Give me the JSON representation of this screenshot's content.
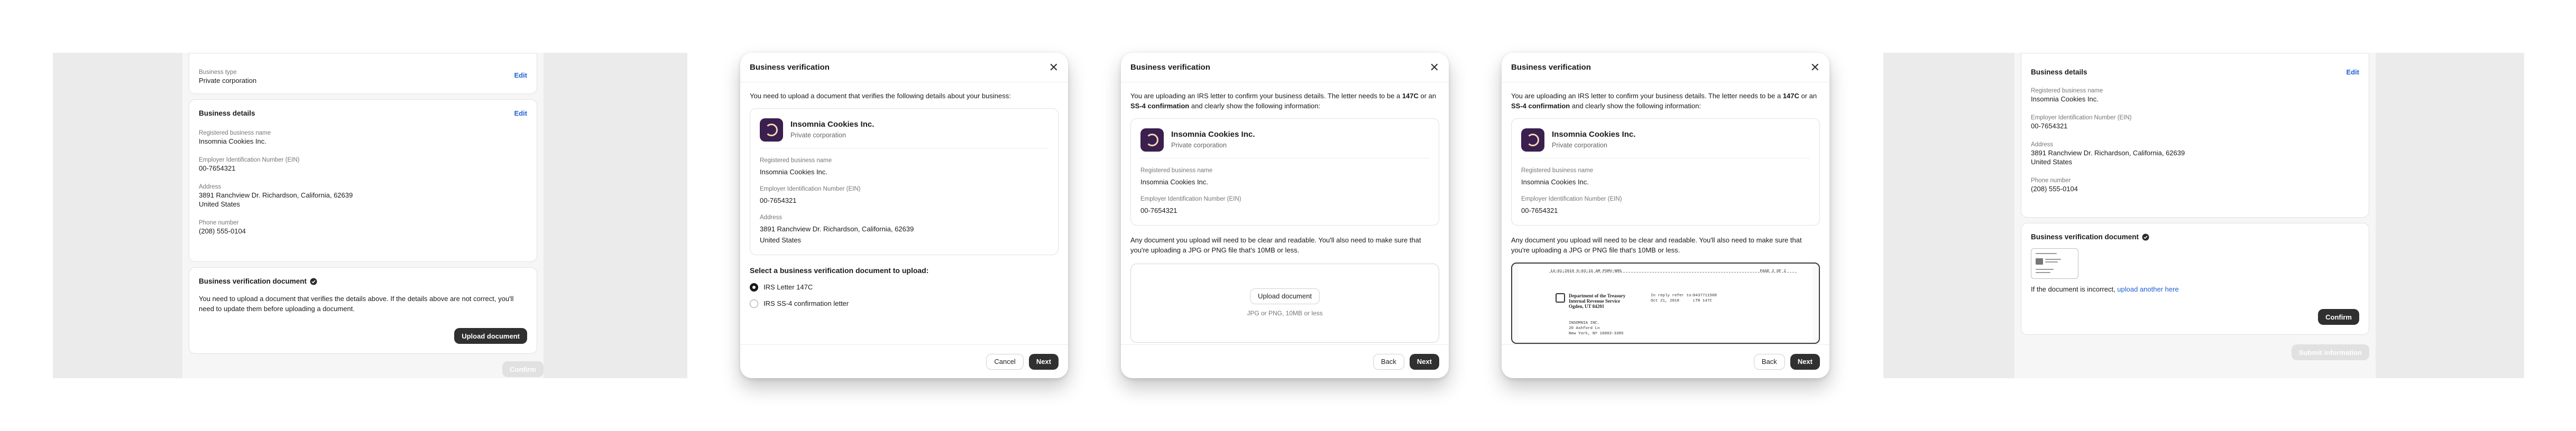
{
  "colors": {
    "accent": "#1f5fd6",
    "primary_button": "#303030",
    "panel_bg": "#ebebeb"
  },
  "icons": {
    "close": "close-icon",
    "verified": "checkmark-badge-icon",
    "company": "company-logo-icon"
  },
  "panel1": {
    "business_type": {
      "label": "Business type",
      "value": "Private corporation",
      "edit": "Edit"
    },
    "business_details": {
      "title": "Business details",
      "edit": "Edit",
      "fields": [
        {
          "label": "Registered business name",
          "lines": [
            "Insomnia Cookies Inc."
          ]
        },
        {
          "label": "Employer Identification Number (EIN)",
          "lines": [
            "00-7654321"
          ]
        },
        {
          "label": "Address",
          "lines": [
            "3891 Ranchview Dr. Richardson, California, 62639",
            "United States"
          ]
        },
        {
          "label": "Phone number",
          "lines": [
            "(208) 555-0104"
          ]
        }
      ]
    },
    "verification": {
      "title": "Business verification document",
      "text": "You need to upload a document that verifies the details above. If the details above are not correct, you'll need to update them before uploading a document.",
      "upload_button": "Upload document"
    },
    "confirm_button": "Confirm"
  },
  "dialog1": {
    "title": "Business verification",
    "intro": "You need to upload a document that verifies the following details about your business:",
    "company": {
      "name": "Insomnia Cookies Inc.",
      "type": "Private corporation"
    },
    "fields": [
      {
        "label": "Registered business name",
        "lines": [
          "Insomnia Cookies Inc."
        ]
      },
      {
        "label": "Employer Identification Number (EIN)",
        "lines": [
          "00-7654321"
        ]
      },
      {
        "label": "Address",
        "lines": [
          "3891 Ranchview Dr. Richardson, California, 62639",
          "United States"
        ]
      }
    ],
    "select_heading": "Select a business verification document to upload:",
    "options": [
      "IRS Letter 147C",
      "IRS SS-4 confirmation letter"
    ],
    "selected": "IRS Letter 147C",
    "cancel": "Cancel",
    "next": "Next"
  },
  "dialog2": {
    "title": "Business verification",
    "intro": {
      "p1": "You are uploading an IRS letter to confirm your business details. The letter needs to be a ",
      "b1": "147C",
      "p2": " or an ",
      "b2": "SS-4 confirmation",
      "p3": " and clearly show the following information:"
    },
    "company": {
      "name": "Insomnia Cookies Inc.",
      "type": "Private corporation"
    },
    "fields": [
      {
        "label": "Registered business name",
        "lines": [
          "Insomnia Cookies Inc."
        ]
      },
      {
        "label": "Employer Identification Number (EIN)",
        "lines": [
          "00-7654321"
        ]
      }
    ],
    "note": "Any document you upload will need to be clear and readable. You'll also need to make sure that you're uploading a JPG or PNG file that's 10MB or less.",
    "upload_button": "Upload document",
    "upload_hint": "JPG or PNG, 10MB or less",
    "back": "Back",
    "next": "Next"
  },
  "dialog3": {
    "title": "Business verification",
    "intro": {
      "p1": "You are uploading an IRS letter to confirm your business details. The letter needs to be a ",
      "b1": "147C",
      "p2": " or an ",
      "b2": "SS-4 confirmation",
      "p3": " and clearly show the following information:"
    },
    "company": {
      "name": "Insomnia Cookies Inc.",
      "type": "Private corporation"
    },
    "fields": [
      {
        "label": "Registered business name",
        "lines": [
          "Insomnia Cookies Inc."
        ]
      },
      {
        "label": "Employer Identification Number (EIN)",
        "lines": [
          "00-7654321"
        ]
      }
    ],
    "note": "Any document you upload will need to be clear and readable. You'll also need to make sure that you're uploading a JPG or PNG file that's 10MB or less.",
    "letter": {
      "header_left": "14:01:2019 9:03:16 AM  PSMV-NMS",
      "header_right": "PAGE 2  OF 2",
      "agency": [
        "Department of the Treasury",
        "Internal Revenue Service",
        "Ogden, UT 84201"
      ],
      "mid_col": [
        "In reply refer to:",
        "Oct 21, 2018"
      ],
      "right_col": [
        "0437711508",
        "LTR 147C"
      ],
      "addressee": [
        "INSOMNIA INC.",
        "20 Ashford Ln",
        "New York, NY 10003-3385"
      ]
    },
    "back": "Back",
    "next": "Next"
  },
  "panel5": {
    "business_details": {
      "title": "Business details",
      "edit": "Edit",
      "fields": [
        {
          "label": "Registered business name",
          "lines": [
            "Insomnia Cookies Inc."
          ]
        },
        {
          "label": "Employer Identification Number (EIN)",
          "lines": [
            "00-7654321"
          ]
        },
        {
          "label": "Address",
          "lines": [
            "3891 Ranchview Dr. Richardson, California, 62639",
            "United States"
          ]
        },
        {
          "label": "Phone number",
          "lines": [
            "(208) 555-0104"
          ]
        }
      ]
    },
    "verification": {
      "title": "Business verification document",
      "incorrect_text": "If the document is incorrect, ",
      "upload_link": "upload another here",
      "confirm_button": "Confirm"
    },
    "submit_button": "Submit information"
  }
}
